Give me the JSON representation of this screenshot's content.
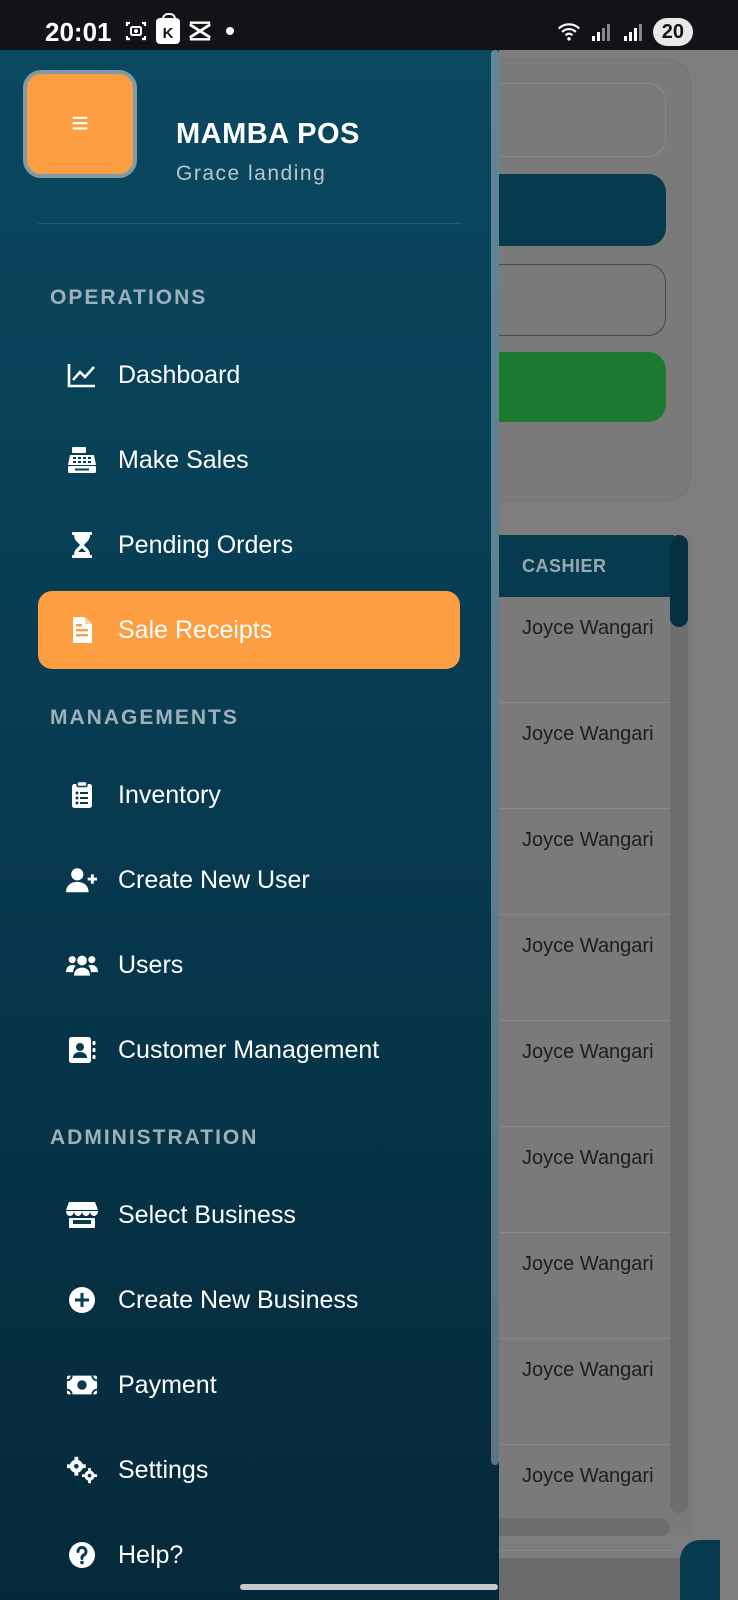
{
  "status_bar": {
    "time": "20:01",
    "k_badge": "K",
    "battery": "20",
    "icons": [
      "screenshot-icon",
      "shopping-bag-icon",
      "capcut-icon",
      "dot-icon",
      "wifi-icon",
      "signal-icon",
      "signal-icon-2"
    ]
  },
  "drawer": {
    "logo_glyph": "≡",
    "app_name": "MAMBA POS",
    "business_name": "Grace landing",
    "sections": {
      "operations": "OPERATIONS",
      "managements": "MANAGEMENTS",
      "administration": "ADMINISTRATION"
    },
    "items": {
      "dashboard": "Dashboard",
      "make_sales": "Make Sales",
      "pending_orders": "Pending Orders",
      "sale_receipts": "Sale Receipts",
      "inventory": "Inventory",
      "create_new_user": "Create New User",
      "users": "Users",
      "customer_management": "Customer Management",
      "select_business": "Select Business",
      "create_new_business": "Create New Business",
      "payment": "Payment",
      "settings": "Settings",
      "help": "Help?"
    },
    "active_item": "Sale Receipts",
    "colors": {
      "drawer_top": "#0a4860",
      "drawer_bottom": "#05293a",
      "accent": "#fd9e43"
    }
  },
  "background": {
    "table_header": "CASHIER",
    "rows": [
      "Joyce Wangari",
      "Joyce Wangari",
      "Joyce Wangari",
      "Joyce Wangari",
      "Joyce Wangari",
      "Joyce Wangari",
      "Joyce Wangari",
      "Joyce Wangari",
      "Joyce Wangari"
    ]
  }
}
